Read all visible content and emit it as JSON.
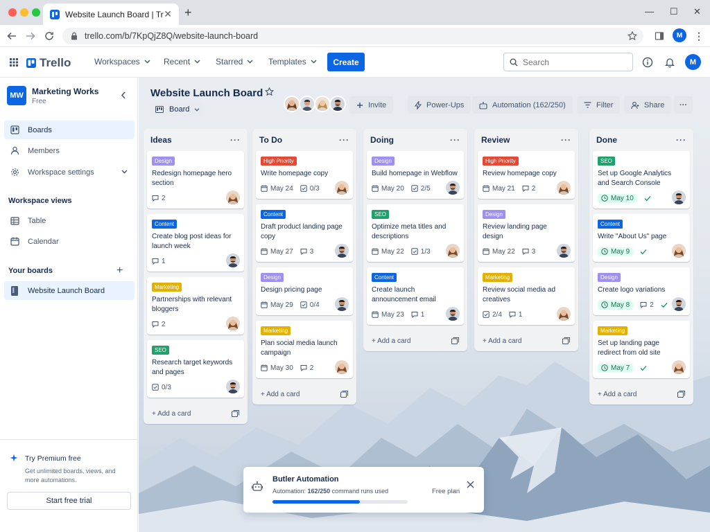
{
  "browser": {
    "tab_title": "Website Launch Board | Trello",
    "url": "trello.com/b/7KpQjZ8Q/website-launch-board",
    "profile_initial": "M"
  },
  "header": {
    "logo_text": "Trello",
    "menu": [
      "Workspaces",
      "Recent",
      "Starred",
      "Templates"
    ],
    "create_label": "Create",
    "search_placeholder": "Search",
    "avatar_initial": "M"
  },
  "sidebar": {
    "workspace_initials": "MW",
    "workspace_name": "Marketing Works",
    "workspace_plan": "Free",
    "nav": [
      {
        "label": "Boards",
        "icon": "boards-icon",
        "active": true
      },
      {
        "label": "Members",
        "icon": "members-icon"
      },
      {
        "label": "Workspace settings",
        "icon": "gear-icon"
      }
    ],
    "views_heading": "Workspace views",
    "views": [
      {
        "label": "Table",
        "icon": "table-icon"
      },
      {
        "label": "Calendar",
        "icon": "calendar-icon"
      }
    ],
    "boards_heading": "Your boards",
    "boards": [
      {
        "label": "Website Launch Board"
      }
    ],
    "premium": {
      "title": "Try Premium free",
      "text": "Get unlimited boards, views, and more automations.",
      "button": "Start free trial"
    }
  },
  "board": {
    "title": "Website Launch Board",
    "view_label": "Board",
    "invite_label": "Invite",
    "powerups_label": "Power-Ups",
    "automation_label": "Automation (162/250)",
    "filter_label": "Filter",
    "share_label": "Share",
    "more_label": "···",
    "add_card_label": "Add a card"
  },
  "colors": {
    "Design": "#9f8fef",
    "Content": "#0c66e4",
    "Marketing": "#e2b203",
    "SEO": "#22a06b",
    "High Priority": "#e34935"
  },
  "lists": [
    {
      "title": "Ideas",
      "cards": [
        {
          "label": "Design",
          "title": "Redesign homepage hero section",
          "comments": "2",
          "avatar": "woman"
        },
        {
          "label": "Content",
          "title": "Create blog post ideas for launch week",
          "comments": "1",
          "avatar": "man"
        },
        {
          "label": "Marketing",
          "title": "Partnerships with relevant bloggers",
          "comments": "2",
          "avatar": "woman"
        },
        {
          "label": "SEO",
          "title": "Research target keywords and pages",
          "checklist": "0/3",
          "avatar": "man"
        }
      ]
    },
    {
      "title": "To Do",
      "cards": [
        {
          "label": "High Priority",
          "title": "Write homepage copy",
          "date": "May 24",
          "checklist": "0/3",
          "avatar": "woman"
        },
        {
          "label": "Content",
          "title": "Draft product landing page copy",
          "date": "May 27",
          "comments": "3",
          "avatar": "man"
        },
        {
          "label": "Design",
          "title": "Design pricing page",
          "date": "May 29",
          "checklist": "0/4",
          "avatar": "man"
        },
        {
          "label": "Marketing",
          "title": "Plan social media launch campaign",
          "date": "May 30",
          "comments": "2",
          "avatar": "woman"
        }
      ]
    },
    {
      "title": "Doing",
      "cards": [
        {
          "label": "Design",
          "title": "Build homepage in Webflow",
          "date": "May 20",
          "checklist": "2/5",
          "avatar": "man"
        },
        {
          "label": "SEO",
          "title": "Optimize meta titles and descriptions",
          "date": "May 22",
          "checklist": "1/3",
          "avatar": "woman"
        },
        {
          "label": "Content",
          "title": "Create launch announcement email",
          "date": "May 23",
          "comments": "1",
          "avatar": "man"
        }
      ]
    },
    {
      "title": "Review",
      "cards": [
        {
          "label": "High Priority",
          "title": "Review homepage copy",
          "date": "May 21",
          "comments": "2",
          "avatar": "woman"
        },
        {
          "label": "Design",
          "title": "Review landing page design",
          "date": "May 22",
          "comments": "3",
          "avatar": "man"
        },
        {
          "label": "Marketing",
          "title": "Review social media ad creatives",
          "checklist": "2/4",
          "comments": "1",
          "avatar": "woman"
        }
      ]
    },
    {
      "title": "Done",
      "cards": [
        {
          "label": "SEO",
          "title": "Set up Google Analytics and Search Console",
          "due": "May 10",
          "avatar": "man"
        },
        {
          "label": "Content",
          "title": "Write \"About Us\" page",
          "due": "May 9",
          "avatar": "woman"
        },
        {
          "label": "Design",
          "title": "Create logo variations",
          "due": "May 8",
          "comments": "2",
          "avatar": "man"
        },
        {
          "label": "Marketing",
          "title": "Set up landing page redirect from old site",
          "due": "May 7",
          "avatar": "woman"
        }
      ]
    }
  ],
  "automation_panel": {
    "title": "Butler Automation",
    "usage_prefix": "Automation:",
    "usage_value": "162/250",
    "usage_suffix": "command runs used",
    "progress": 0.648,
    "plan": "Free plan"
  }
}
